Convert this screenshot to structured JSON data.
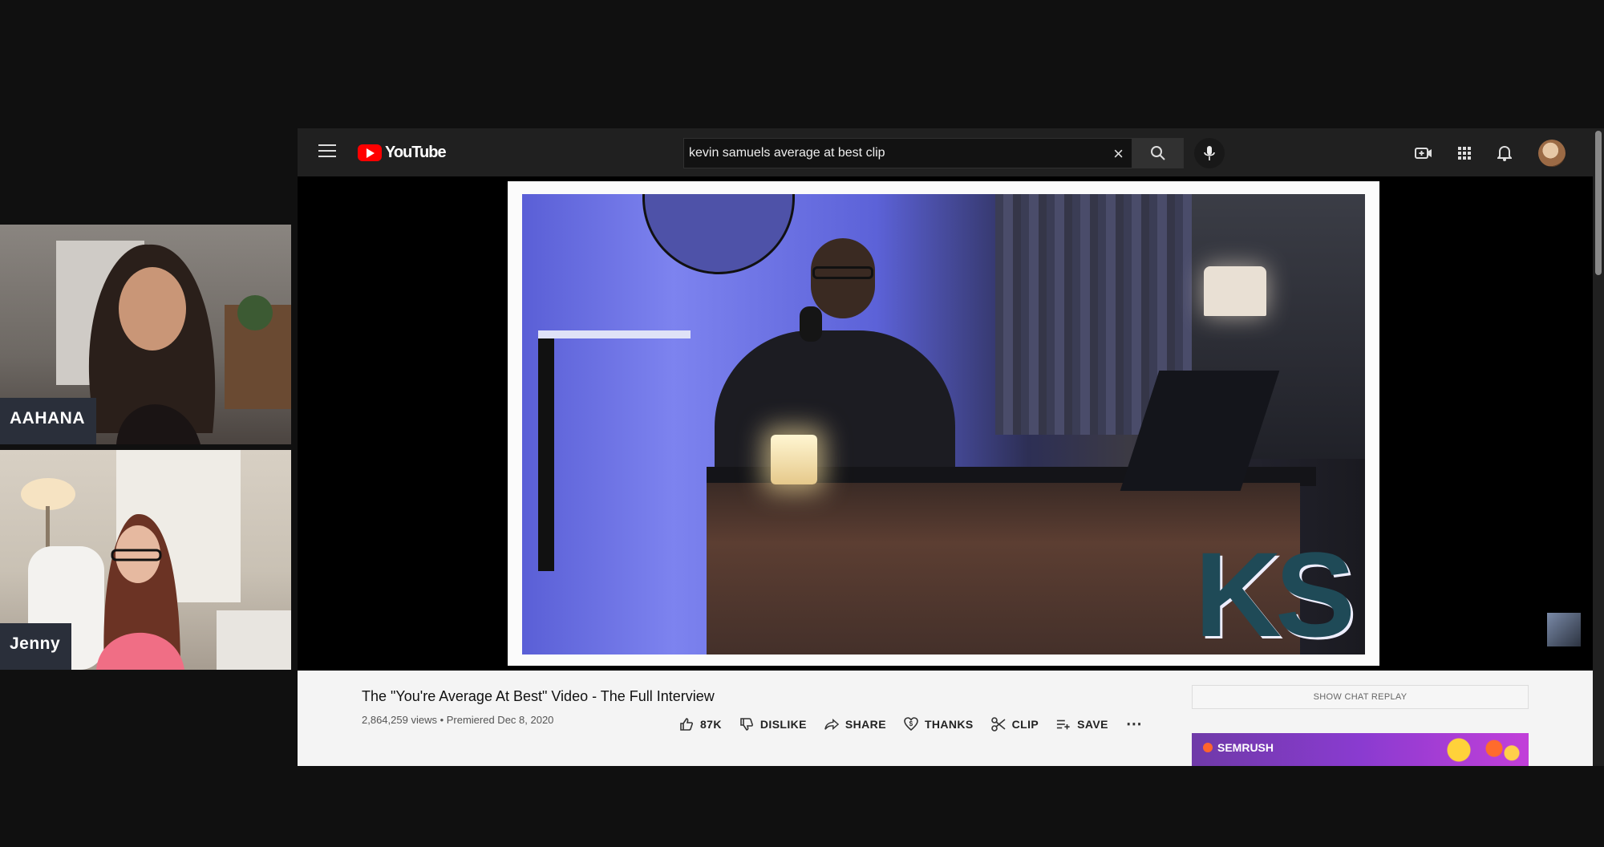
{
  "participants": [
    {
      "name": "AAHANA"
    },
    {
      "name": "Jenny"
    }
  ],
  "youtube": {
    "logo_text": "YouTube",
    "search": {
      "value": "kevin samuels average at best clip"
    },
    "video": {
      "title": "The \"You're Average At Best\" Video - The Full Interview",
      "meta": "2,864,259 views • Premiered Dec 8, 2020",
      "watermark": "KS"
    },
    "actions": {
      "like": "87K",
      "dislike": "DISLIKE",
      "share": "SHARE",
      "thanks": "THANKS",
      "clip": "CLIP",
      "save": "SAVE"
    },
    "chat_replay": "SHOW CHAT REPLAY",
    "ad": {
      "brand": "SEMRUSH"
    }
  },
  "colors": {
    "yt_red": "#ff0000",
    "header_bg": "#202020",
    "ad_purple": "#8a3bd0"
  },
  "icons": [
    "menu-icon",
    "search-icon",
    "clear-icon",
    "mic-icon",
    "create-video-icon",
    "apps-icon",
    "notifications-icon",
    "like-icon",
    "dislike-icon",
    "share-icon",
    "thanks-icon",
    "clip-icon",
    "save-icon",
    "more-icon"
  ]
}
